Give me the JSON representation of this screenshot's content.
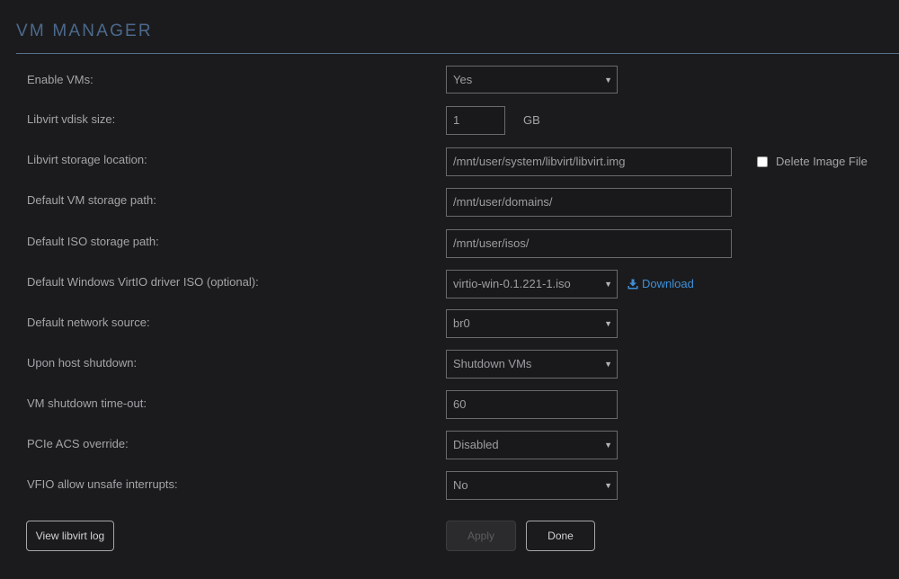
{
  "header": {
    "title": "VM MANAGER"
  },
  "settings": [
    {
      "label": "Enable VMs:",
      "value": "Yes",
      "control": "select"
    },
    {
      "label": "Libvirt vdisk size:",
      "value": "1",
      "unit": "GB",
      "control": "input"
    },
    {
      "label": "Libvirt storage location:",
      "value": "/mnt/user/system/libvirt/libvirt.img",
      "control": "input",
      "checkbox_label": "Delete Image File",
      "checkbox_checked": false
    },
    {
      "label": "Default VM storage path:",
      "value": "/mnt/user/domains/",
      "control": "input"
    },
    {
      "label": "Default ISO storage path:",
      "value": "/mnt/user/isos/",
      "control": "input"
    },
    {
      "label": "Default Windows VirtIO driver ISO (optional):",
      "value": "virtio-win-0.1.221-1.iso",
      "control": "select",
      "link_label": "Download",
      "link_icon": "download-icon"
    },
    {
      "label": "Default network source:",
      "value": "br0",
      "control": "select"
    },
    {
      "label": "Upon host shutdown:",
      "value": "Shutdown VMs",
      "control": "select"
    },
    {
      "label": "VM shutdown time-out:",
      "value": "60",
      "control": "input"
    },
    {
      "label": "PCIe ACS override:",
      "value": "Disabled",
      "control": "select"
    },
    {
      "label": "VFIO allow unsafe interrupts:",
      "value": "No",
      "control": "select"
    }
  ],
  "buttons": {
    "view_log": "View libvirt log",
    "apply": "Apply",
    "done": "Done"
  },
  "colors": {
    "background": "#1b1b1d",
    "title": "#4c6a8d",
    "link": "#3f8fd6"
  }
}
